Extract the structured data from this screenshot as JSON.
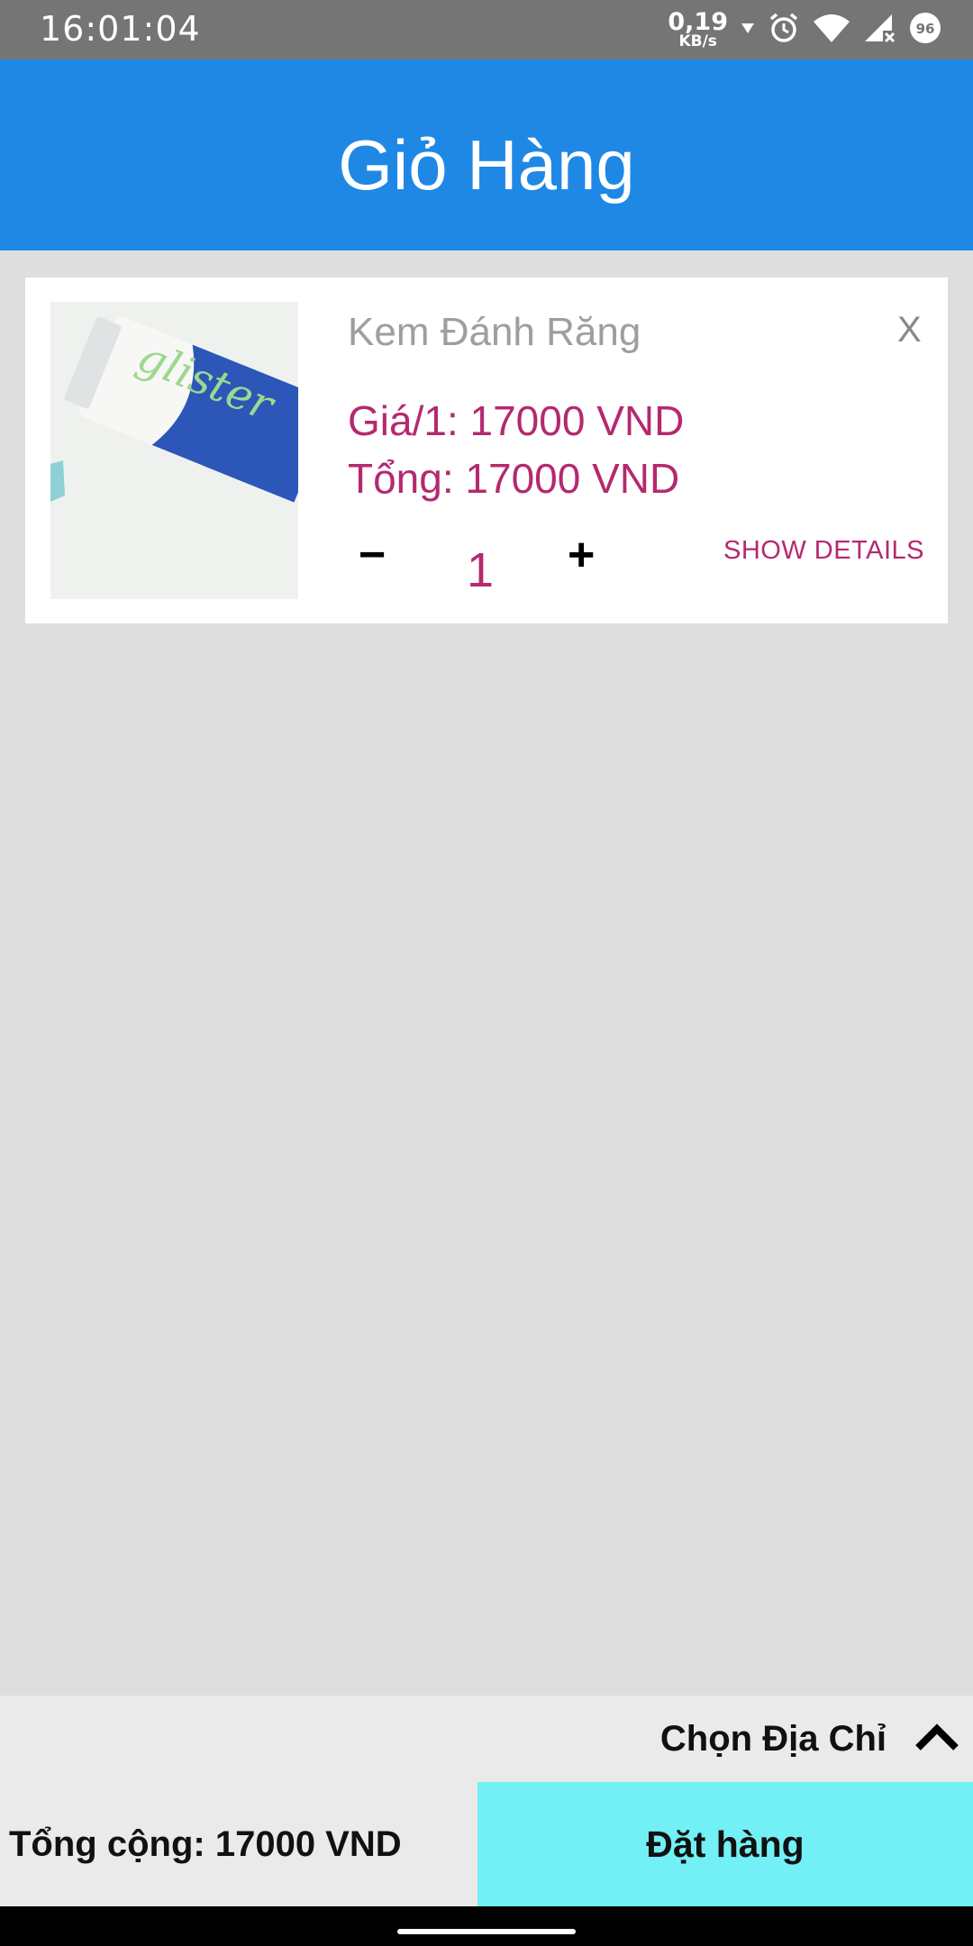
{
  "status_bar": {
    "time": "16:01:04",
    "net_speed_value": "0,19",
    "net_speed_unit": "KB/s",
    "battery": "96"
  },
  "header": {
    "title": "Giỏ Hàng"
  },
  "cart_item": {
    "image_text": "glister",
    "name": "Kem Đánh Răng",
    "remove_label": "X",
    "unit_price": "Giá/1: 17000 VND",
    "line_total": "Tổng: 17000 VND",
    "qty_minus": "−",
    "quantity": "1",
    "qty_plus": "+",
    "show_details": "SHOW DETAILS"
  },
  "footer": {
    "address_label": "Chọn Địa Chỉ",
    "total": "Tổng cộng: 17000 VND",
    "order_button": "Đặt hàng"
  },
  "colors": {
    "header_bg": "#1f88e5",
    "accent_text": "#b5296f",
    "order_button_bg": "#72f0f5",
    "page_bg": "#dedede"
  }
}
